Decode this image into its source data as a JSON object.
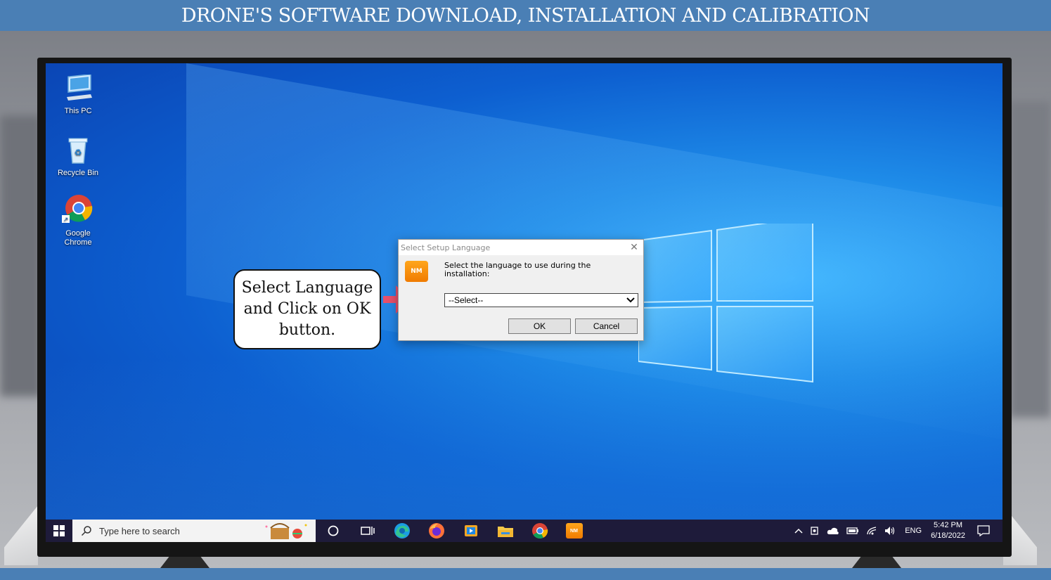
{
  "header": {
    "title": "DRONE'S SOFTWARE DOWNLOAD, INSTALLATION AND CALIBRATION"
  },
  "desktop": {
    "icons": [
      {
        "label": "This PC",
        "icon": "this-pc-icon"
      },
      {
        "label": "Recycle Bin",
        "icon": "recycle-bin-icon"
      },
      {
        "label": "Google Chrome",
        "icon": "chrome-icon"
      }
    ]
  },
  "callout": {
    "text": "Select Language and Click on OK button."
  },
  "dialog": {
    "title": "Select Setup Language",
    "logo_text": "NM",
    "prompt": "Select the language to use during the installation:",
    "select_value": "--Select--",
    "ok_label": "OK",
    "cancel_label": "Cancel"
  },
  "taskbar": {
    "search_placeholder": "Type here to search",
    "apps": [
      "task-view",
      "edge",
      "firefox",
      "media-player",
      "file-explorer",
      "chrome",
      "nm-app"
    ],
    "language": "ENG",
    "time": "5:42 PM",
    "date": "6/18/2022"
  },
  "colors": {
    "header_bg": "#4a7fb5",
    "taskbar_bg": "#1e1b3a",
    "desktop_accent": "#1e8be8",
    "nm_orange": "#f28a0c"
  }
}
